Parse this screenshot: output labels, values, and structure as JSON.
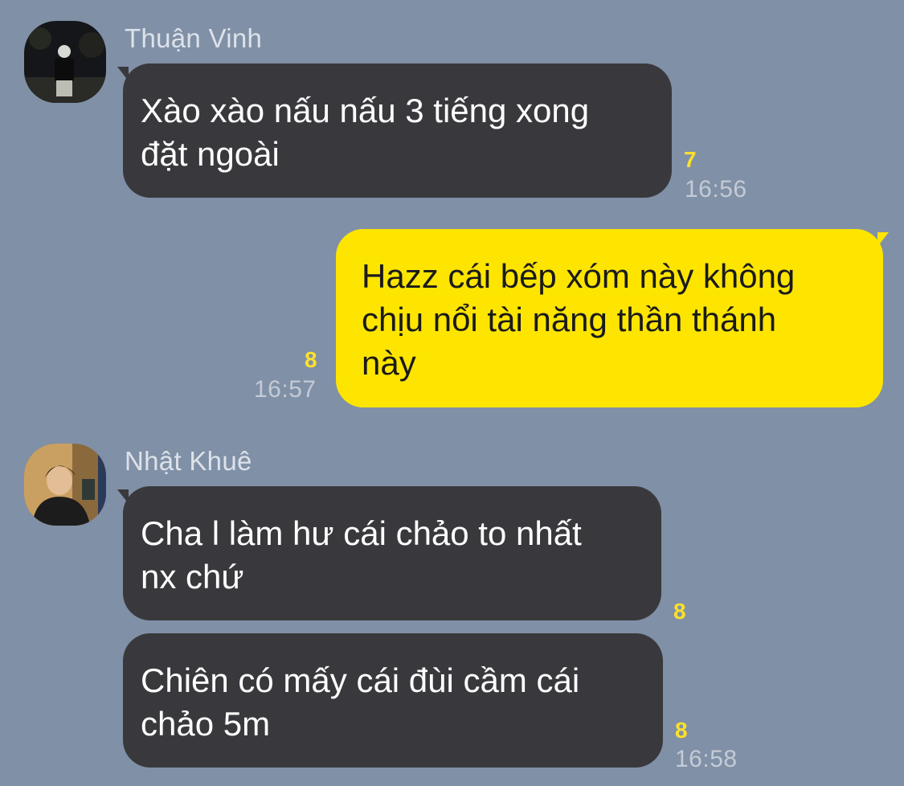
{
  "conversation": {
    "messages": [
      {
        "sender": "Thuận Vinh",
        "direction": "incoming",
        "text": "Xào xào nấu nấu 3 tiếng xong\nđặt ngoài",
        "unread": "7",
        "time": "16:56"
      },
      {
        "sender": "",
        "direction": "outgoing",
        "text": "Hazz cái bếp xóm này không\nchịu nổi tài năng thần thánh\nnày",
        "unread": "8",
        "time": "16:57"
      },
      {
        "sender": "Nhật Khuê",
        "direction": "incoming",
        "text": "Cha l làm hư cái chảo to nhất\nnx chứ",
        "unread": "8",
        "time": ""
      },
      {
        "sender": "Nhật Khuê",
        "direction": "incoming",
        "text": "Chiên có mấy cái đùi cầm cái\nchảo 5m",
        "unread": "8",
        "time": "16:58"
      }
    ]
  },
  "colors": {
    "background": "#8090a6",
    "incoming_bubble": "#39393d",
    "outgoing_bubble": "#fee500",
    "unread_count": "#fde12a"
  }
}
